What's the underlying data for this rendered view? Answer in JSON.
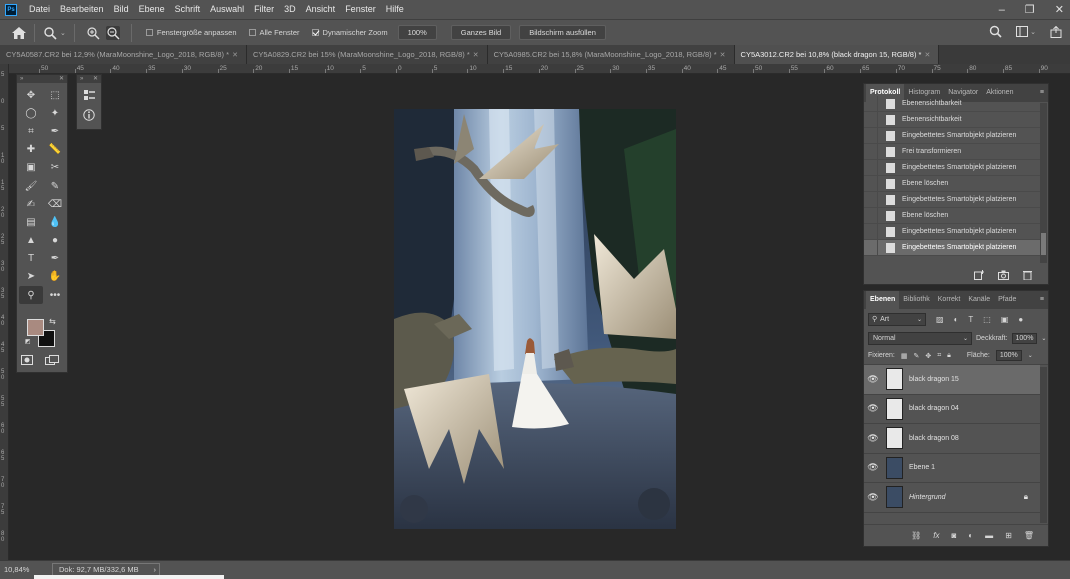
{
  "app": {
    "logo": "Ps",
    "menu": [
      "Datei",
      "Bearbeiten",
      "Bild",
      "Ebene",
      "Schrift",
      "Auswahl",
      "Filter",
      "3D",
      "Ansicht",
      "Fenster",
      "Hilfe"
    ],
    "window_controls": [
      "–",
      "❐",
      "✕"
    ]
  },
  "options_bar": {
    "fit_window_label": "Fenstergröße anpassen",
    "fit_window_checked": false,
    "all_windows_label": "Alle Fenster",
    "all_windows_checked": false,
    "scrubby_zoom_label": "Dynamischer Zoom",
    "scrubby_zoom_checked": true,
    "zoom_percent": "100%",
    "fit_screen_label": "Ganzes Bild",
    "fill_screen_label": "Bildschirm ausfüllen"
  },
  "doc_tabs": [
    {
      "label": "CY5A0587.CR2 bei 12,9% (MaraMoonshine_Logo_2018, RGB/8) *",
      "active": false
    },
    {
      "label": "CY5A0829.CR2 bei 15% (MaraMoonshine_Logo_2018, RGB/8) *",
      "active": false
    },
    {
      "label": "CY5A0985.CR2 bei 15,8% (MaraMoonshine_Logo_2018, RGB/8) *",
      "active": false
    },
    {
      "label": "CY5A3012.CR2 bei 10,8% (black dragon 15, RGB/8) *",
      "active": true
    }
  ],
  "ruler_top_labels": [
    "50",
    "45",
    "40",
    "35",
    "30",
    "25",
    "20",
    "15",
    "10",
    "5",
    "0",
    "5",
    "10",
    "15",
    "20",
    "25",
    "30",
    "35",
    "40",
    "45",
    "50",
    "55",
    "60",
    "65",
    "70",
    "75",
    "80",
    "85",
    "90"
  ],
  "ruler_left_labels": [
    "5",
    "0",
    "5",
    "1 0",
    "1 5",
    "2 0",
    "2 5",
    "3 0",
    "3 5",
    "4 0",
    "4 5",
    "5 0",
    "5 5",
    "6 0",
    "6 5",
    "7 0",
    "7 5",
    "8 0"
  ],
  "tools": [
    {
      "name": "move-tool-icon",
      "glyph": "✥"
    },
    {
      "name": "marquee-tool-icon",
      "glyph": "⬚"
    },
    {
      "name": "lasso-tool-icon",
      "glyph": "◯"
    },
    {
      "name": "magic-wand-icon",
      "glyph": "✦"
    },
    {
      "name": "crop-tool-icon",
      "glyph": "⌗"
    },
    {
      "name": "eyedropper-icon",
      "glyph": "✒"
    },
    {
      "name": "healing-brush-icon",
      "glyph": "✚"
    },
    {
      "name": "ruler-tool-icon",
      "glyph": "📏"
    },
    {
      "name": "stamp-tool-icon",
      "glyph": "▣"
    },
    {
      "name": "history-brush-icon",
      "glyph": "✂"
    },
    {
      "name": "brush-tool-icon",
      "glyph": "🖌"
    },
    {
      "name": "pencil-tool-icon",
      "glyph": "✎"
    },
    {
      "name": "art-brush-icon",
      "glyph": "✍"
    },
    {
      "name": "eraser-tool-icon",
      "glyph": "⌫"
    },
    {
      "name": "gradient-tool-icon",
      "glyph": "▤"
    },
    {
      "name": "blur-tool-icon",
      "glyph": "💧"
    },
    {
      "name": "dodge-tool-icon",
      "glyph": "▲"
    },
    {
      "name": "sponge-tool-icon",
      "glyph": "●"
    },
    {
      "name": "type-tool-icon",
      "glyph": "T"
    },
    {
      "name": "pen-tool-icon",
      "glyph": "✒"
    },
    {
      "name": "path-select-icon",
      "glyph": "➤"
    },
    {
      "name": "hand-tool-icon",
      "glyph": "✋"
    },
    {
      "name": "zoom-tool-icon",
      "glyph": "⚲"
    },
    {
      "name": "more-tools-icon",
      "glyph": "•••"
    }
  ],
  "colors": {
    "foreground": "#a98a80",
    "background": "#111111",
    "accent": "#31a8ff"
  },
  "history_panel": {
    "tabs": [
      "Protokoll",
      "Histogram",
      "Navigator",
      "Aktionen"
    ],
    "active_tab": "Protokoll",
    "items": [
      "Ebenensichtbarkeit",
      "Ebenensichtbarkeit",
      "Eingebettetes Smartobjekt platzieren",
      "Frei transformieren",
      "Eingebettetes Smartobjekt platzieren",
      "Ebene löschen",
      "Eingebettetes Smartobjekt platzieren",
      "Ebene löschen",
      "Eingebettetes Smartobjekt platzieren",
      "Eingebettetes Smartobjekt platzieren"
    ]
  },
  "layers_panel": {
    "tabs": [
      "Ebenen",
      "Bibliothk",
      "Korrekt",
      "Kanäle",
      "Pfade"
    ],
    "active_tab": "Ebenen",
    "filter_kind": "Art",
    "blend_mode": "Normal",
    "opacity_label": "Deckkraft:",
    "opacity_value": "100%",
    "lock_label": "Fixieren:",
    "fill_label": "Fläche:",
    "fill_value": "100%",
    "layers": [
      {
        "name": "black dragon 15",
        "selected": true,
        "italic": false,
        "locked": false
      },
      {
        "name": "black dragon 04",
        "selected": false,
        "italic": false,
        "locked": false
      },
      {
        "name": "black dragon 08",
        "selected": false,
        "italic": false,
        "locked": false
      },
      {
        "name": "Ebene 1",
        "selected": false,
        "italic": false,
        "locked": false
      },
      {
        "name": "Hintergrund",
        "selected": false,
        "italic": true,
        "locked": true
      }
    ]
  },
  "status": {
    "zoom": "10,84%",
    "doc_size": "Dok: 92,7 MB/332,6 MB",
    "arrow": "›"
  }
}
